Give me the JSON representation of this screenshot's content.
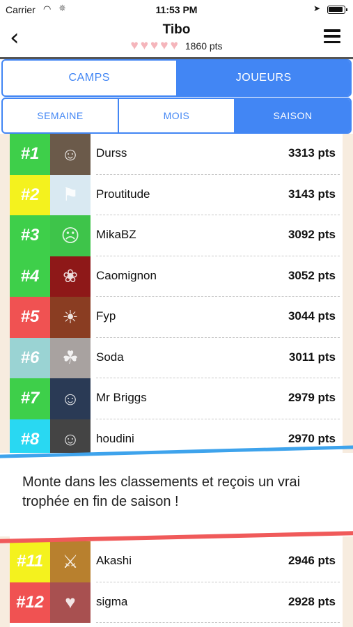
{
  "status_bar": {
    "carrier": "Carrier",
    "time": "11:53 PM"
  },
  "header": {
    "title": "Tibo",
    "hearts": 5,
    "points": "1860 pts"
  },
  "tabs_primary": [
    {
      "label": "CAMPS",
      "active": false
    },
    {
      "label": "JOUEURS",
      "active": true
    }
  ],
  "tabs_period": [
    {
      "label": "SEMAINE",
      "active": false
    },
    {
      "label": "MOIS",
      "active": false
    },
    {
      "label": "SAISON",
      "active": true
    }
  ],
  "ranking": [
    {
      "rank": "#1",
      "name": "Durss",
      "score": "3313 pts",
      "color": "#3ecf4a",
      "avatar_bg": "#6b5a4a",
      "icon": "person-icon"
    },
    {
      "rank": "#2",
      "name": "Proutitude",
      "score": "3143 pts",
      "color": "#f4f21e",
      "avatar_bg": "#d9e9f2",
      "icon": "figure-icon"
    },
    {
      "rank": "#3",
      "name": "MikaBZ",
      "score": "3092 pts",
      "color": "#3ecf4a",
      "avatar_bg": "#3ec44a",
      "icon": "face-icon"
    },
    {
      "rank": "#4",
      "name": "Caomignon",
      "score": "3052 pts",
      "color": "#3ecf4a",
      "avatar_bg": "#8e1818",
      "icon": "flower-icon"
    },
    {
      "rank": "#5",
      "name": "Fyp",
      "score": "3044 pts",
      "color": "#f05252",
      "avatar_bg": "#8a3d22",
      "icon": "sunset-icon"
    },
    {
      "rank": "#6",
      "name": "Soda",
      "score": "3011 pts",
      "color": "#9ad3d3",
      "avatar_bg": "#a8a2a0",
      "icon": "cat-icon"
    },
    {
      "rank": "#7",
      "name": "Mr Briggs",
      "score": "2979 pts",
      "color": "#3ecf4a",
      "avatar_bg": "#2a3a55",
      "icon": "person-icon"
    },
    {
      "rank": "#8",
      "name": "houdini",
      "score": "2970 pts",
      "color": "#29d8f2",
      "avatar_bg": "#444444",
      "icon": "person-icon"
    },
    {
      "rank": "#11",
      "name": "Akashi",
      "score": "2946 pts",
      "color": "#f4f21e",
      "avatar_bg": "#b8802e",
      "icon": "fighter-icon"
    },
    {
      "rank": "#12",
      "name": "sigma",
      "score": "2928 pts",
      "color": "#f05252",
      "avatar_bg": "#a85050",
      "icon": "lady-icon"
    }
  ],
  "promo": {
    "message": "Monte dans les classements et reçois un vrai trophée en fin de saison !"
  }
}
